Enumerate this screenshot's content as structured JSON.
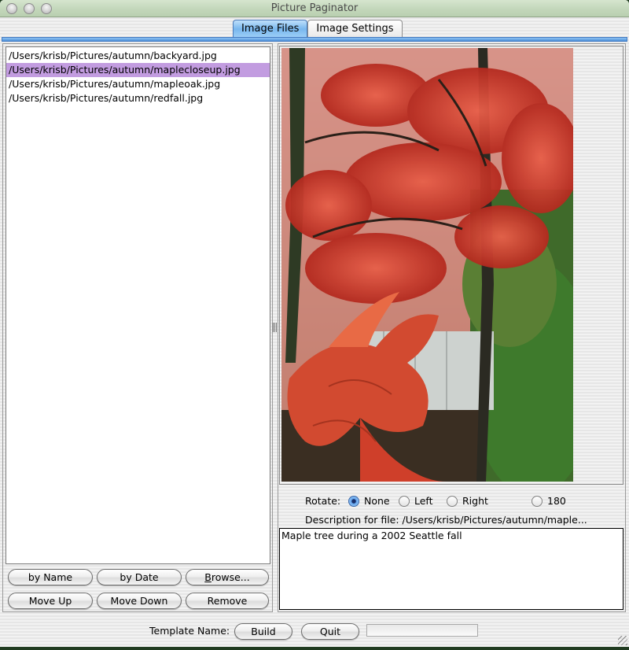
{
  "window": {
    "title": "Picture Paginator"
  },
  "tabs": [
    {
      "label": "Image Files",
      "active": true
    },
    {
      "label": "Image Settings",
      "active": false
    }
  ],
  "file_list": {
    "items": [
      {
        "path": "/Users/krisb/Pictures/autumn/backyard.jpg",
        "selected": false
      },
      {
        "path": "/Users/krisb/Pictures/autumn/maplecloseup.jpg",
        "selected": true
      },
      {
        "path": "/Users/krisb/Pictures/autumn/mapleoak.jpg",
        "selected": false
      },
      {
        "path": "/Users/krisb/Pictures/autumn/redfall.jpg",
        "selected": false
      }
    ],
    "selection_color": "#c29ce0"
  },
  "list_buttons": {
    "by_name": "by Name",
    "by_date": "by Date",
    "browse": "Browse...",
    "move_up": "Move Up",
    "move_down": "Move Down",
    "remove": "Remove"
  },
  "preview": {
    "image_description": "Photo of red autumn maple leaves in the foreground with trees and a white fence behind"
  },
  "rotate": {
    "label": "Rotate:",
    "options": [
      {
        "label": "None",
        "checked": true
      },
      {
        "label": "Left",
        "checked": false
      },
      {
        "label": "Right",
        "checked": false
      },
      {
        "label": "180",
        "checked": false
      }
    ]
  },
  "description": {
    "label": "Description for file: /Users/krisb/Pictures/autumn/maple...",
    "value": "Maple tree during a 2002 Seattle fall"
  },
  "bottom": {
    "template_label": "Template Name:",
    "build": "Build",
    "quit": "Quit",
    "template_value": ""
  },
  "colors": {
    "tab_active": "#78b7ee",
    "titlebar": "#c4d8bc"
  }
}
